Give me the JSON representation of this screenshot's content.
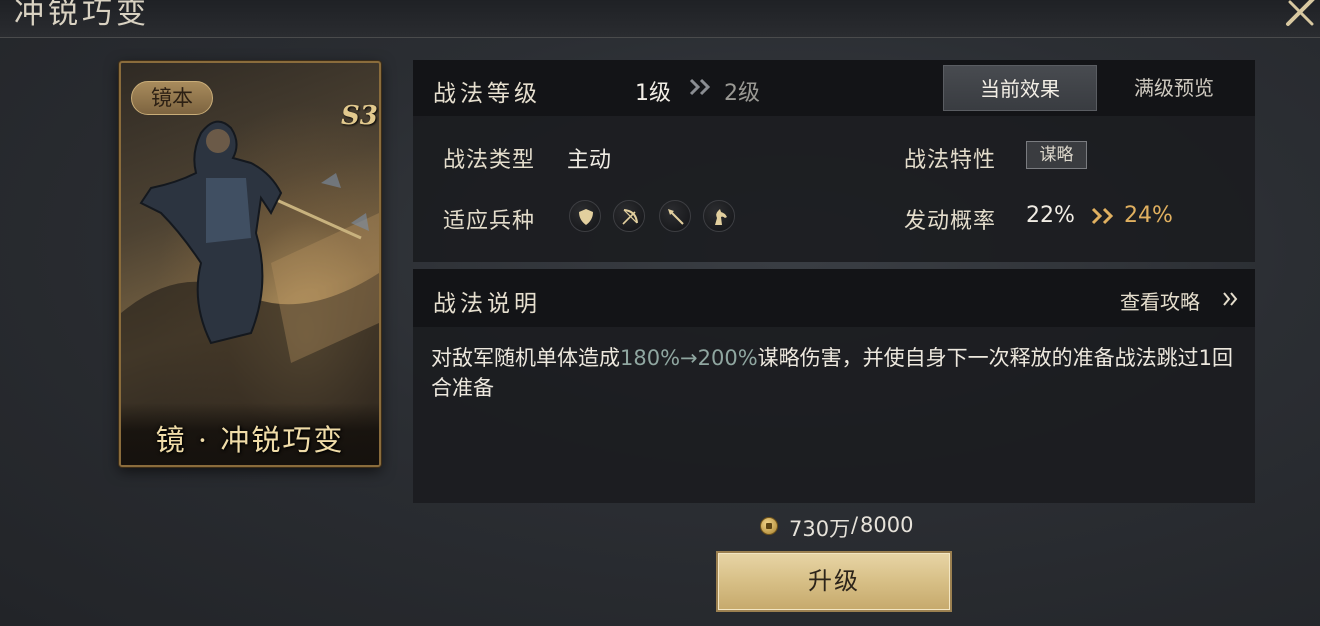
{
  "window": {
    "title": "冲锐巧变"
  },
  "card": {
    "tag": "镜本",
    "grade": "S3",
    "name": "镜 · 冲锐巧变"
  },
  "tactic_info": {
    "level_label": "战法等级",
    "level_current": "1级",
    "level_next": "2级",
    "tabs": [
      {
        "label": "当前效果",
        "active": true
      },
      {
        "label": "满级预览",
        "active": false
      }
    ],
    "type_label": "战法类型",
    "type_value": "主动",
    "trait_label": "战法特性",
    "trait_value": "谋略",
    "troops_label": "适应兵种",
    "troop_icons": [
      "shield-icon",
      "bow-icon",
      "spear-icon",
      "horse-icon"
    ],
    "rate_label": "发动概率",
    "rate_current": "22%",
    "rate_next": "24%"
  },
  "description": {
    "title": "战法说明",
    "guide_link": "查看攻略",
    "text_before": "对敌军随机单体造成",
    "text_highlight": "180%→200%",
    "text_after": "谋略伤害，并使自身下一次释放的准备战法跳过1回合准备"
  },
  "cost": {
    "owned": "730万",
    "separator": "/",
    "required": "8000"
  },
  "upgrade_button": {
    "label": "升级"
  },
  "colors": {
    "accent_gold": "#e0b060",
    "highlight": "#8fa6a0",
    "button": "#d7bf86"
  }
}
